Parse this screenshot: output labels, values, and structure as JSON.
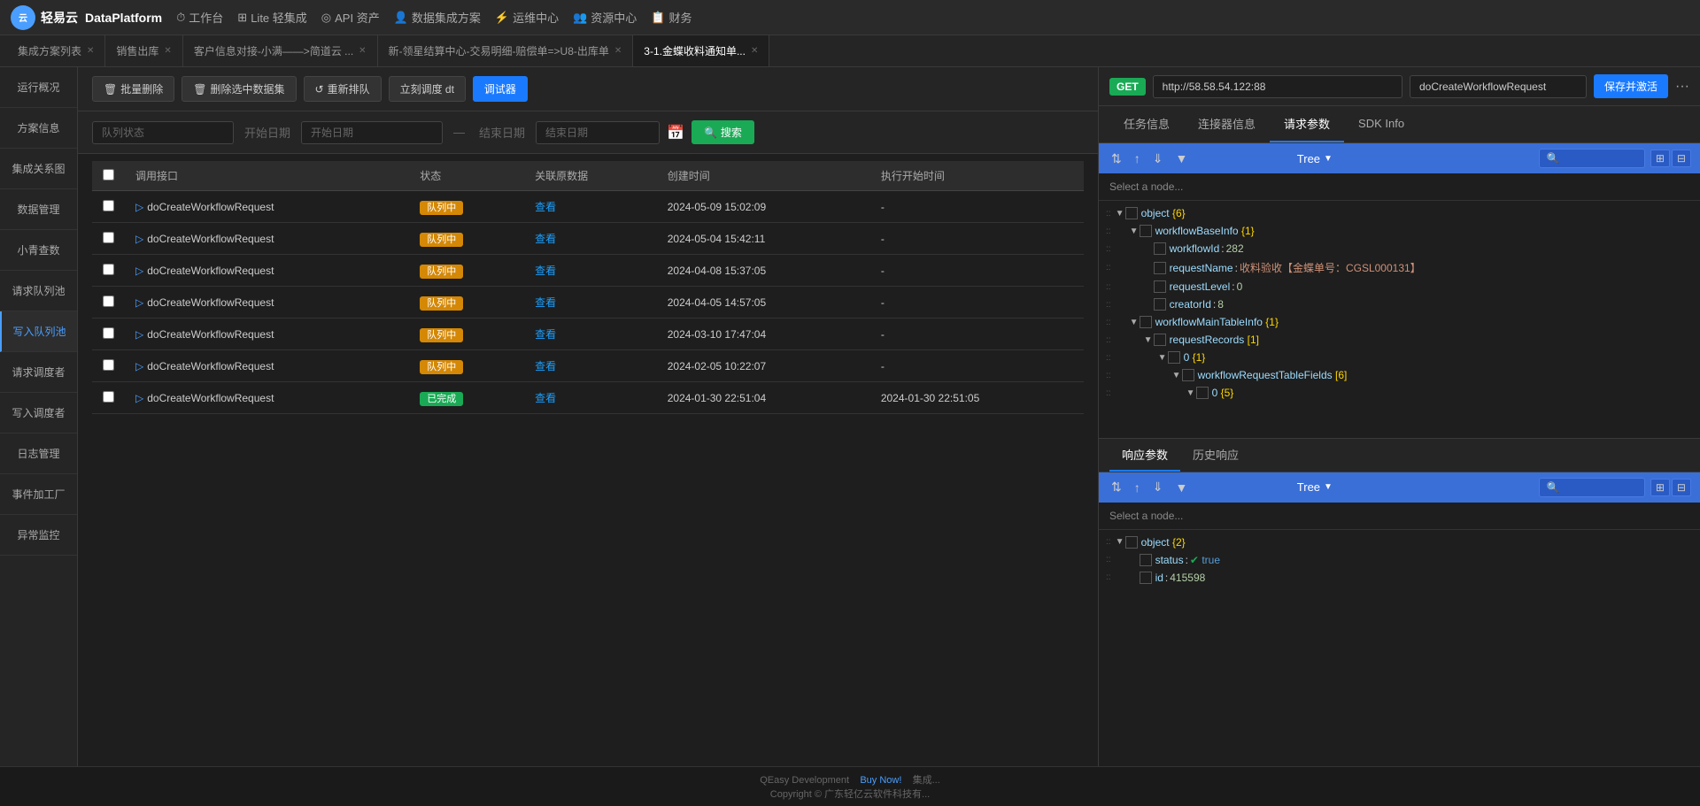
{
  "topNav": {
    "logo": "轻易云",
    "appName": "DataPlatform",
    "items": [
      {
        "label": "工作台",
        "icon": "⏱"
      },
      {
        "label": "Lite 轻集成",
        "icon": "⊞"
      },
      {
        "label": "API 资产",
        "icon": "◎"
      },
      {
        "label": "数据集成方案",
        "icon": "👤"
      },
      {
        "label": "运维中心",
        "icon": "⚡"
      },
      {
        "label": "资源中心",
        "icon": "👥"
      },
      {
        "label": "财务",
        "icon": "📋"
      }
    ]
  },
  "tabs": [
    {
      "label": "集成方案列表",
      "active": false,
      "closable": true
    },
    {
      "label": "销售出库",
      "active": false,
      "closable": true
    },
    {
      "label": "客户信息对接-小满——>简道云 ...",
      "active": false,
      "closable": true
    },
    {
      "label": "新-领星结算中心-交易明细-赔偿单=>U8-出库单",
      "active": false,
      "closable": true
    },
    {
      "label": "3-1.金蝶收料通知单...",
      "active": true,
      "closable": true
    }
  ],
  "sidebar": {
    "items": [
      {
        "label": "运行概况",
        "active": false
      },
      {
        "label": "方案信息",
        "active": false
      },
      {
        "label": "集成关系图",
        "active": false
      },
      {
        "label": "数据管理",
        "active": false
      },
      {
        "label": "小青查数",
        "active": false
      },
      {
        "label": "请求队列池",
        "active": false
      },
      {
        "label": "写入队列池",
        "active": true
      },
      {
        "label": "请求调度者",
        "active": false
      },
      {
        "label": "写入调度者",
        "active": false
      },
      {
        "label": "日志管理",
        "active": false
      },
      {
        "label": "事件加工厂",
        "active": false
      },
      {
        "label": "异常监控",
        "active": false
      }
    ]
  },
  "toolbar": {
    "batchDelete": "批量删除",
    "deleteFilter": "删除选中数据集",
    "requeue": "重新排队",
    "scheduleNow": "立刻调度 dt",
    "debug": "调试器"
  },
  "filter": {
    "queueStatus": "队列状态",
    "startDate": "开始日期",
    "endDate": "结束日期",
    "searchBtn": "搜索"
  },
  "table": {
    "columns": [
      "",
      "调用接口",
      "状态",
      "关联原数据",
      "创建时间",
      "执行开始时间"
    ],
    "rows": [
      {
        "interface": "doCreateWorkflowRequest",
        "status": "队列中",
        "statusType": "queue",
        "relData": "查看",
        "createTime": "2024-05-09 15:02:09",
        "startTime": "-"
      },
      {
        "interface": "doCreateWorkflowRequest",
        "status": "队列中",
        "statusType": "queue",
        "relData": "查看",
        "createTime": "2024-05-04 15:42:11",
        "startTime": "-"
      },
      {
        "interface": "doCreateWorkflowRequest",
        "status": "队列中",
        "statusType": "queue",
        "relData": "查看",
        "createTime": "2024-04-08 15:37:05",
        "startTime": "-"
      },
      {
        "interface": "doCreateWorkflowRequest",
        "status": "队列中",
        "statusType": "queue",
        "relData": "查看",
        "createTime": "2024-04-05 14:57:05",
        "startTime": "-"
      },
      {
        "interface": "doCreateWorkflowRequest",
        "status": "队列中",
        "statusType": "queue",
        "relData": "查看",
        "createTime": "2024-03-10 17:47:04",
        "startTime": "-"
      },
      {
        "interface": "doCreateWorkflowRequest",
        "status": "队列中",
        "statusType": "queue",
        "relData": "查看",
        "createTime": "2024-02-05 10:22:07",
        "startTime": "-"
      },
      {
        "interface": "doCreateWorkflowRequest",
        "status": "已完成",
        "statusType": "done",
        "relData": "查看",
        "createTime": "2024-01-30 22:51:04",
        "startTime": "2024-01-30 22:51:05"
      }
    ]
  },
  "rightPanel": {
    "method": "GET",
    "url": "http://58.58.54.122:88",
    "funcName": "doCreateWorkflowRequest",
    "saveBtn": "保存并激活",
    "tabs": [
      "任务信息",
      "连接器信息",
      "请求参数",
      "SDK Info"
    ],
    "activeTab": "请求参数",
    "requestTree": {
      "label": "Tree",
      "selectHint": "Select a node...",
      "nodes": [
        {
          "depth": 0,
          "key": "object",
          "bracket": "{6}",
          "type": "object",
          "toggle": "▼",
          "count": ""
        },
        {
          "depth": 1,
          "key": "workflowBaseInfo",
          "bracket": "{1}",
          "type": "object",
          "toggle": "▼",
          "count": ""
        },
        {
          "depth": 2,
          "key": "workflowId",
          "colon": ":",
          "value": "282",
          "type": "number"
        },
        {
          "depth": 2,
          "key": "requestName",
          "colon": ":",
          "value": "收料验收【金蝶单号：CGSL000131】",
          "type": "string"
        },
        {
          "depth": 2,
          "key": "requestLevel",
          "colon": ":",
          "value": "0",
          "type": "number"
        },
        {
          "depth": 2,
          "key": "creatorId",
          "colon": ":",
          "value": "8",
          "type": "number"
        },
        {
          "depth": 1,
          "key": "workflowMainTableInfo",
          "bracket": "{1}",
          "type": "object",
          "toggle": "▼",
          "count": ""
        },
        {
          "depth": 2,
          "key": "requestRecords",
          "bracket": "[1]",
          "type": "array",
          "toggle": "▼",
          "count": ""
        },
        {
          "depth": 3,
          "key": "0",
          "bracket": "{1}",
          "type": "object",
          "toggle": "▼",
          "count": ""
        },
        {
          "depth": 4,
          "key": "workflowRequestTableFields",
          "bracket": "[6]",
          "type": "array",
          "toggle": "▼",
          "count": ""
        },
        {
          "depth": 5,
          "key": "0",
          "bracket": "{5}",
          "type": "object",
          "toggle": "▼",
          "count": ""
        }
      ]
    },
    "responseTabs": [
      "响应参数",
      "历史响应"
    ],
    "activeRespTab": "响应参数",
    "responseTree": {
      "label": "Tree",
      "selectHint": "Select a node...",
      "nodes": [
        {
          "depth": 0,
          "key": "object",
          "bracket": "{2}",
          "type": "object",
          "toggle": "▼",
          "count": ""
        },
        {
          "depth": 1,
          "key": "status",
          "colon": ":",
          "value": "true",
          "type": "bool"
        },
        {
          "depth": 1,
          "key": "id",
          "colon": ":",
          "value": "415598",
          "type": "number"
        }
      ]
    }
  },
  "footer": {
    "text1": "QEasy Development",
    "text2": "Buy Now!",
    "text3": "集成...",
    "copyright": "Copyright © 广东轻亿云软件科技有..."
  }
}
